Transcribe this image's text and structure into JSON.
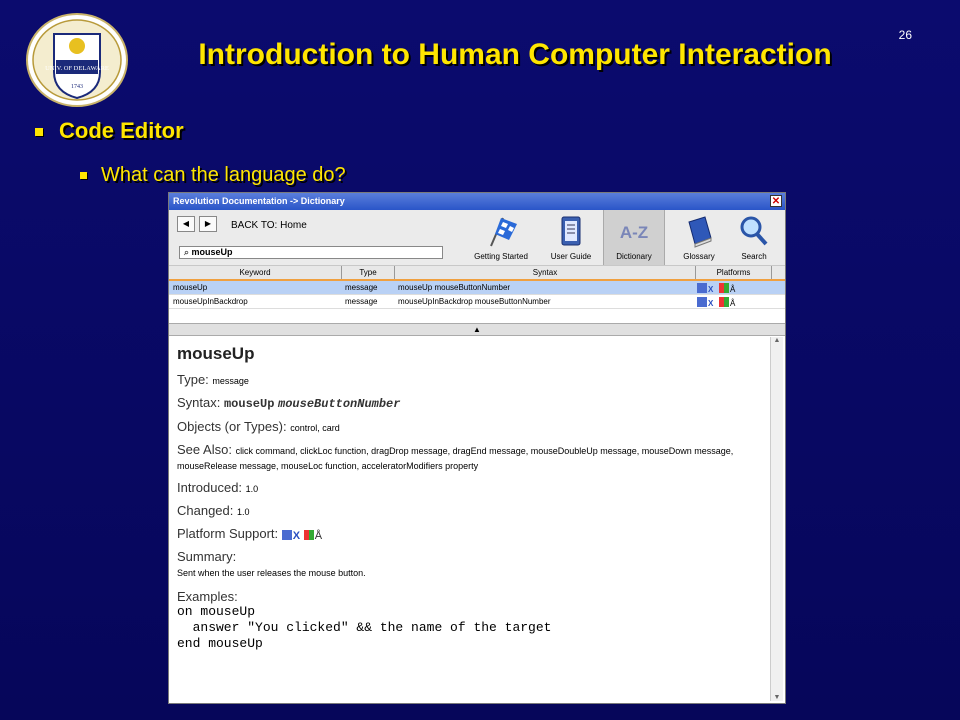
{
  "slide": {
    "title": "Introduction to Human Computer Interaction",
    "number": "26",
    "bullet1": "Code Editor",
    "bullet2": "What can the language do?"
  },
  "logo": {
    "text": "UNIVERSITY OF DELAWARE",
    "year": "1743"
  },
  "window": {
    "title": "Revolution Documentation -> Dictionary",
    "back_to": "BACK TO: Home",
    "search_value": "mouseUp",
    "toolbar_buttons": [
      {
        "label": "Getting Started",
        "icon": "checkered-flag-icon"
      },
      {
        "label": "User Guide",
        "icon": "notepad-icon"
      },
      {
        "label": "Dictionary",
        "icon": "a-z-icon"
      },
      {
        "label": "Glossary",
        "icon": "book-icon"
      },
      {
        "label": "Search",
        "icon": "magnifier-icon"
      }
    ],
    "columns": [
      "Keyword",
      "Type",
      "Syntax",
      "Platforms"
    ],
    "rows": [
      {
        "keyword": "mouseUp",
        "type": "message",
        "syntax": "mouseUp mouseButtonNumber"
      },
      {
        "keyword": "mouseUpInBackdrop",
        "type": "message",
        "syntax": "mouseUpInBackdrop mouseButtonNumber"
      }
    ]
  },
  "entry": {
    "name": "mouseUp",
    "type_label": "Type:",
    "type_value": "message",
    "syntax_label": "Syntax:",
    "syntax_cmd": "mouseUp",
    "syntax_param": "mouseButtonNumber",
    "objects_label": "Objects (or Types):",
    "objects_value": "control, card",
    "see_also_label": "See Also:",
    "see_also_value_1": "click command, clickLoc function, dragDrop message, dragEnd message, mouseDoubleUp message, mouseDown message,",
    "see_also_value_2": "mouseRelease message, mouseLoc function, acceleratorModifiers property",
    "introduced_label": "Introduced:",
    "introduced_value": "1.0",
    "changed_label": "Changed:",
    "changed_value": "1.0",
    "platform_label": "Platform Support:",
    "summary_label": "Summary:",
    "summary_value": "Sent when the user releases the mouse button.",
    "examples_label": "Examples:",
    "example_lines": [
      "on mouseUp",
      "  answer \"You clicked\" && the name of the target",
      "end mouseUp"
    ]
  }
}
